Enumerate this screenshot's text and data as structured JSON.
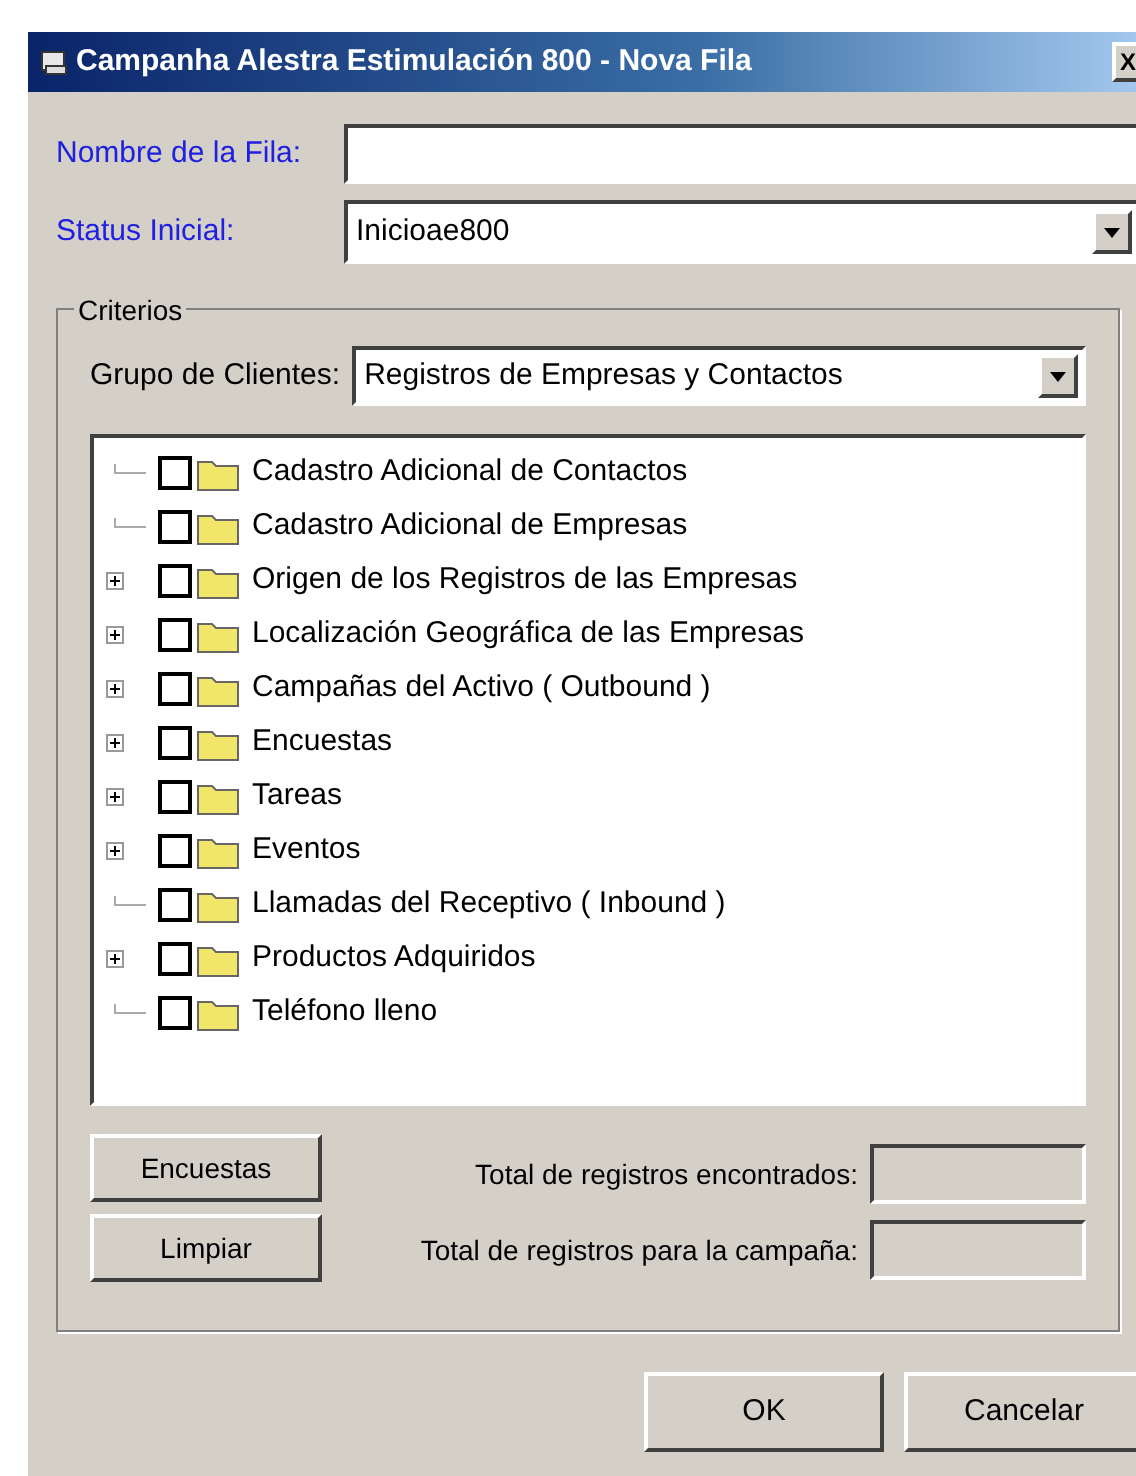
{
  "window": {
    "title": "Campanha Alestra Estimulación 800 - Nova Fila",
    "close": "X"
  },
  "fields": [
    {
      "label": "Nombre de la Fila:",
      "kind": "text"
    },
    {
      "label": "Status Inicial:",
      "kind": "dropdown",
      "value": "Inicioae800"
    }
  ],
  "group": {
    "title": "Criterios",
    "client_group": {
      "label": "Grupo de Clientes:",
      "value": "Registros de Empresas y Contactos"
    },
    "tree": [
      {
        "label": "Cadastro Adicional de Contactos",
        "expandable": false,
        "checked": false
      },
      {
        "label": "Cadastro Adicional de Empresas",
        "expandable": false,
        "checked": false
      },
      {
        "label": "Origen de los Registros de las Empresas",
        "expandable": true,
        "checked": false
      },
      {
        "label": "Localización Geográfica de las Empresas",
        "expandable": true,
        "checked": false
      },
      {
        "label": "Campañas del Activo ( Outbound )",
        "expandable": true,
        "checked": false
      },
      {
        "label": "Encuestas",
        "expandable": true,
        "checked": false
      },
      {
        "label": "Tareas",
        "expandable": true,
        "checked": false
      },
      {
        "label": "Eventos",
        "expandable": true,
        "checked": false
      },
      {
        "label": "Llamadas del Receptivo ( Inbound )",
        "expandable": false,
        "checked": false
      },
      {
        "label": "Productos Adquiridos",
        "expandable": true,
        "checked": false
      },
      {
        "label": "Teléfono lleno",
        "expandable": false,
        "checked": false
      }
    ],
    "buttons": [
      "Encuestas",
      "Limpiar"
    ],
    "totals": [
      {
        "label": "Total de registros encontrados:"
      },
      {
        "label": "Total de registros para la campaña:"
      }
    ]
  },
  "buttons": [
    "OK",
    "Cancelar"
  ]
}
